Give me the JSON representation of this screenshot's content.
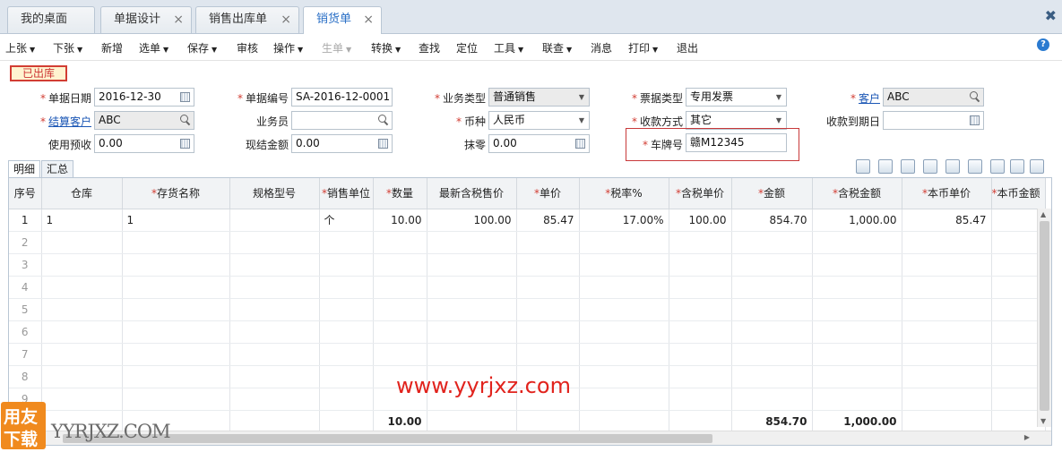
{
  "tabs": [
    {
      "label": "我的桌面",
      "closable": false
    },
    {
      "label": "单据设计",
      "closable": true
    },
    {
      "label": "销售出库单",
      "closable": true
    },
    {
      "label": "销货单",
      "closable": true,
      "active": true
    }
  ],
  "tab_close_glyph": "×",
  "window_close_glyph": "✖",
  "toolbar": [
    {
      "label": "上张",
      "dropdown": true
    },
    {
      "label": "下张",
      "dropdown": true
    },
    {
      "label": "新增",
      "dropdown": false
    },
    {
      "label": "选单",
      "dropdown": true
    },
    {
      "label": "保存",
      "dropdown": true
    },
    {
      "label": "审核",
      "dropdown": false
    },
    {
      "label": "操作",
      "dropdown": true
    },
    {
      "label": "生单",
      "dropdown": true,
      "disabled": true
    },
    {
      "label": "转换",
      "dropdown": true
    },
    {
      "label": "查找",
      "dropdown": false
    },
    {
      "label": "定位",
      "dropdown": false
    },
    {
      "label": "工具",
      "dropdown": true
    },
    {
      "label": "联查",
      "dropdown": true
    },
    {
      "label": "消息",
      "dropdown": false
    },
    {
      "label": "打印",
      "dropdown": true
    },
    {
      "label": "退出",
      "dropdown": false
    }
  ],
  "help_glyph": "?",
  "status": "已出库",
  "form": {
    "doc_date": {
      "label": "单据日期",
      "value": "2016-12-30"
    },
    "doc_no": {
      "label": "单据编号",
      "value": "SA-2016-12-0001"
    },
    "biz_type": {
      "label": "业务类型",
      "value": "普通销售"
    },
    "invoice_type": {
      "label": "票据类型",
      "value": "专用发票"
    },
    "customer": {
      "label": "客户",
      "value": "ABC"
    },
    "settle_customer": {
      "label": "结算客户",
      "value": "ABC"
    },
    "salesman": {
      "label": "业务员",
      "value": ""
    },
    "currency": {
      "label": "币种",
      "value": "人民币"
    },
    "payment_method": {
      "label": "收款方式",
      "value": "其它"
    },
    "due_date": {
      "label": "收款到期日",
      "value": ""
    },
    "prepaid": {
      "label": "使用预收",
      "value": "0.00"
    },
    "cash_amount": {
      "label": "现结金额",
      "value": "0.00"
    },
    "rounding": {
      "label": "抹零",
      "value": "0.00"
    },
    "plate_no": {
      "label": "车牌号",
      "value": "赣M12345"
    }
  },
  "inner_tabs": [
    "明细",
    "汇总"
  ],
  "grid": {
    "headers": [
      {
        "label": "序号",
        "req": false
      },
      {
        "label": "仓库",
        "req": false
      },
      {
        "label": "存货名称",
        "req": true
      },
      {
        "label": "规格型号",
        "req": false
      },
      {
        "label": "销售单位",
        "req": true
      },
      {
        "label": "数量",
        "req": true
      },
      {
        "label": "最新含税售价",
        "req": false
      },
      {
        "label": "单价",
        "req": true
      },
      {
        "label": "税率%",
        "req": true
      },
      {
        "label": "含税单价",
        "req": true
      },
      {
        "label": "金额",
        "req": true
      },
      {
        "label": "含税金额",
        "req": true
      },
      {
        "label": "本币单价",
        "req": true
      },
      {
        "label": "本币金额",
        "req": true
      }
    ],
    "rows": [
      [
        "1",
        "1",
        "1",
        "",
        "个",
        "10.00",
        "100.00",
        "85.47",
        "17.00%",
        "100.00",
        "854.70",
        "1,000.00",
        "85.47",
        ""
      ],
      [
        "2"
      ],
      [
        "3"
      ],
      [
        "4"
      ],
      [
        "5"
      ],
      [
        "6"
      ],
      [
        "7"
      ],
      [
        "8"
      ],
      [
        "9"
      ]
    ],
    "totals": {
      "qty": "10.00",
      "amount": "854.70",
      "tax_amount": "1,000.00"
    }
  },
  "watermark": {
    "url": "www.yyrjxz.com",
    "logo_line1": "用友",
    "logo_line2": "下载",
    "site": "YYRJXZ.COM"
  }
}
